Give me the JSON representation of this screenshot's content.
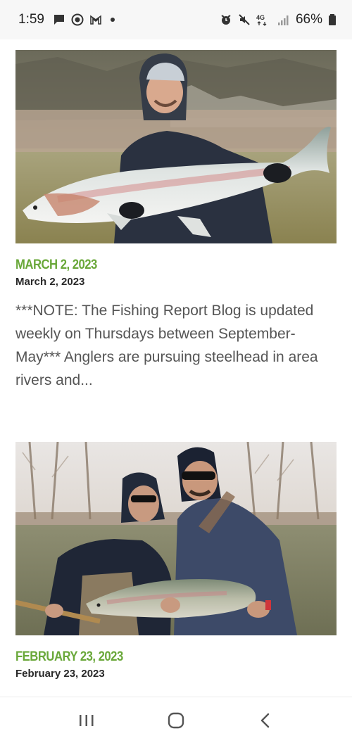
{
  "status_bar": {
    "time": "1:59",
    "battery": "66%",
    "left_icons": [
      "chat-icon",
      "circle-check-icon",
      "gmail-icon"
    ],
    "right_icons": [
      "alarm-icon",
      "mute-icon",
      "lte-data-icon",
      "signal-icon",
      "battery-icon"
    ]
  },
  "posts": [
    {
      "date_heading": "MARCH 2, 2023",
      "date_sub": "March 2, 2023",
      "excerpt": "***NOTE: The Fishing Report Blog is updated weekly on Thursdays between September-May*** Anglers are pursuing steelhead in area rivers and..."
    },
    {
      "date_heading": "FEBRUARY 23, 2023",
      "date_sub": "February 23, 2023"
    }
  ],
  "nav_bar": {
    "buttons": [
      "recents-icon",
      "home-icon",
      "back-icon"
    ]
  },
  "colors": {
    "accent_green": "#6aa83a",
    "status_bar_bg": "#f7f7f7"
  }
}
